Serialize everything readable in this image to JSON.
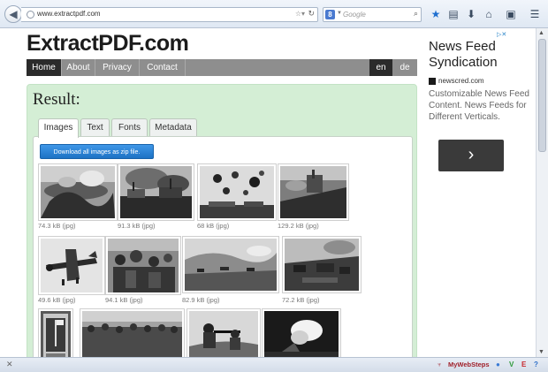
{
  "browser": {
    "url": "www.extractpdf.com",
    "search_engine_icon": "8",
    "search_placeholder": "Google",
    "icons": [
      "back-icon",
      "globe-icon",
      "dropdown-icon",
      "reload-icon",
      "search-icon",
      "bookmark-star-icon",
      "reading-list-icon",
      "download-icon",
      "home-icon",
      "screenshot-icon",
      "menu-icon"
    ]
  },
  "site": {
    "logo": "ExtractPDF.com",
    "nav": [
      "Home",
      "About",
      "Privacy",
      "Contact"
    ],
    "active_nav": "Home",
    "languages": [
      "en",
      "de"
    ],
    "active_language": "en"
  },
  "result": {
    "title": "Result:",
    "tabs": [
      "Images",
      "Text",
      "Fonts",
      "Metadata"
    ],
    "active_tab": "Images",
    "download_button": "Download all images as zip file.",
    "images": [
      {
        "caption": "74.3 kB (jpg)",
        "scene": "aerial-harbor-smoke-icon"
      },
      {
        "caption": "91.3 kB (jpg)",
        "scene": "ships-burning-icon"
      },
      {
        "caption": "68 kB (jpg)",
        "scene": "flak-bursts-icon"
      },
      {
        "caption": "129.2 kB (jpg)",
        "scene": "ship-deck-icon"
      },
      {
        "caption": "49.6 kB (jpg)",
        "scene": "fighter-plane-icon"
      },
      {
        "caption": "94.1 kB (jpg)",
        "scene": "troops-crowd-icon"
      },
      {
        "caption": "82.9 kB (jpg)",
        "scene": "landing-beach-icon"
      },
      {
        "caption": "72.2 kB (jpg)",
        "scene": "battlefield-icon"
      },
      {
        "caption": "",
        "scene": "flag-raising-stamp-icon"
      },
      {
        "caption": "",
        "scene": "crowd-panorama-icon"
      },
      {
        "caption": "",
        "scene": "soldiers-firing-icon"
      },
      {
        "caption": "",
        "scene": "explosion-night-icon"
      }
    ]
  },
  "ad": {
    "marker": "▷✕",
    "title": "News Feed Syndication",
    "source": "newscred.com",
    "body": "Customizable News Feed Content. News Feeds for Different Verticals.",
    "cta": "›"
  },
  "statusbar": {
    "close": "✕",
    "addon_label": "MyWebSteps",
    "addon_icons": [
      "mywebsteps-icon",
      "status-dot-icon",
      "v-icon",
      "e-icon",
      "help-icon"
    ]
  },
  "colors": {
    "panel_bg": "#d4eed5",
    "nav_bg": "#8e8e8e",
    "nav_active": "#2b2b2b",
    "button_blue": "#1d72c4",
    "ad_cta": "#3a3a3a"
  }
}
